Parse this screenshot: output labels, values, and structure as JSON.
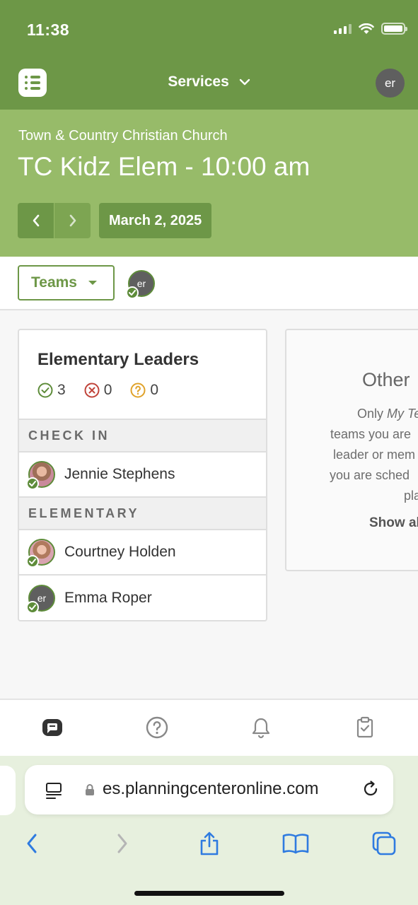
{
  "status_bar": {
    "time": "11:38"
  },
  "app_bar": {
    "title": "Services",
    "avatar_initials": "er"
  },
  "header": {
    "organization": "Town & Country Christian Church",
    "plan_title": "TC Kidz Elem - 10:00 am",
    "date": "March 2, 2025"
  },
  "filter": {
    "teams_label": "Teams",
    "avatar_initials": "er"
  },
  "team_card": {
    "title": "Elementary Leaders",
    "confirmed_count": "3",
    "declined_count": "0",
    "pending_count": "0",
    "sections": [
      {
        "label": "CHECK IN",
        "people": [
          {
            "name": "Jennie Stephens"
          }
        ]
      },
      {
        "label": "ELEMENTARY",
        "people": [
          {
            "name": "Courtney Holden"
          },
          {
            "name": "Emma Roper",
            "initials": "er"
          }
        ]
      }
    ]
  },
  "other_card": {
    "title": "Other",
    "lines": [
      "Only My Teams",
      "teams you are",
      "leader or mem",
      "you are sched",
      "pla"
    ],
    "show_label": "Show al"
  },
  "tab_bar": {
    "items": [
      "services-tab",
      "help-tab",
      "notifications-tab",
      "tasks-tab"
    ]
  },
  "browser": {
    "url": "es.planningcenteronline.com"
  },
  "colors": {
    "primary_green": "#6d9747",
    "header_green": "#97bb69",
    "safari_blue": "#2f7be0"
  }
}
